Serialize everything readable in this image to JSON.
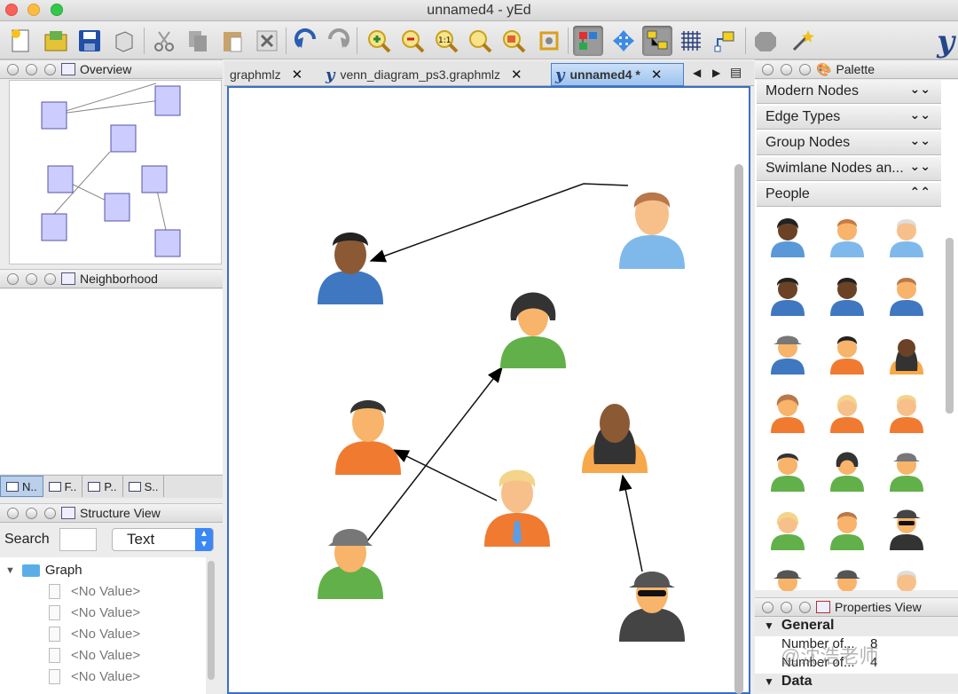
{
  "window": {
    "title": "unnamed4 - yEd"
  },
  "toolbar": {
    "icons": [
      "new-document",
      "open-folder",
      "save",
      "export",
      "cut",
      "copy",
      "paste",
      "delete",
      "undo",
      "redo",
      "zoom-in",
      "zoom-out",
      "zoom-actual",
      "zoom-fit",
      "zoom-area",
      "fit-content",
      "layout-hierarchic",
      "navigate",
      "group",
      "grid",
      "port",
      "layout-gear",
      "magic-wand"
    ],
    "logo": "y"
  },
  "panels": {
    "overview": {
      "title": "Overview"
    },
    "neighborhood": {
      "title": "Neighborhood"
    },
    "bottom_tabs": [
      "N..",
      "F..",
      "P..",
      "S.."
    ],
    "structure": {
      "title": "Structure View",
      "search_label": "Search",
      "search_value": "",
      "filter_value": "Text",
      "root": "Graph",
      "children": [
        "<No Value>",
        "<No Value>",
        "<No Value>",
        "<No Value>",
        "<No Value>"
      ]
    },
    "palette": {
      "title": "Palette",
      "sections": [
        {
          "label": "Modern Nodes",
          "state": "collapsed"
        },
        {
          "label": "Edge Types",
          "state": "collapsed"
        },
        {
          "label": "Group Nodes",
          "state": "collapsed"
        },
        {
          "label": "Swimlane Nodes an...",
          "state": "collapsed"
        },
        {
          "label": "People",
          "state": "expanded"
        }
      ]
    },
    "properties": {
      "title": "Properties View",
      "general_label": "General",
      "rows": [
        {
          "label": "Number of...",
          "value": "8"
        },
        {
          "label": "Number of...",
          "value": "4"
        }
      ],
      "data_label": "Data"
    }
  },
  "tabs": [
    {
      "label": "graphmlz",
      "active": false
    },
    {
      "label": "venn_diagram_ps3.graphmlz",
      "active": false
    },
    {
      "label": "unnamed4 *",
      "active": true
    }
  ],
  "watermark": "@沈浩老师",
  "colors": {
    "accent": "#3a6fc4",
    "node_fill": "#ccccff",
    "selected_tab": "#9ec3ee"
  }
}
